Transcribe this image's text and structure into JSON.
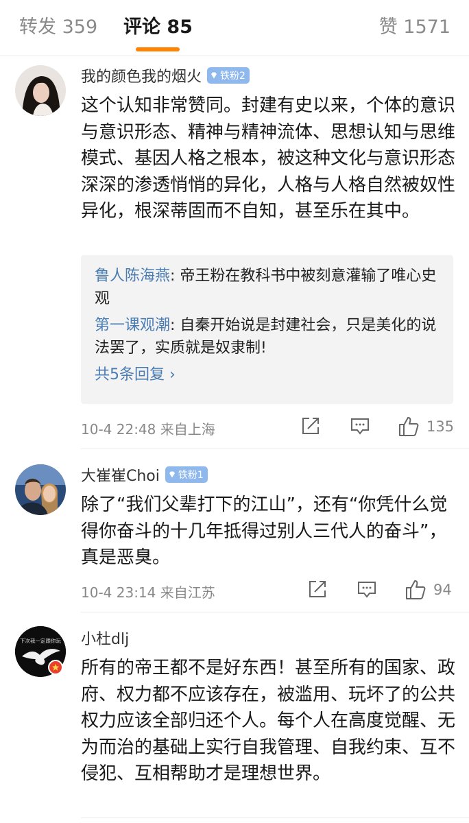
{
  "tabs": {
    "repost_label": "转发 359",
    "comments_label": "评论 85",
    "likes_label": "赞 1571",
    "active_color": "#ff8200"
  },
  "comments": [
    {
      "username": "我的颜色我的烟火",
      "badge": "铁粉2",
      "text": "这个认知非常赞同。封建有史以来，个体的意识与意识形态、精神与精神流体、思想认知与思维模式、基因人格之根本，被这种文化与意识形态深深的渗透悄悄的异化，人格与人格自然被奴性异化，根深蒂固而不自知，甚至乐在其中。",
      "replies": [
        {
          "name": "鲁人陈海燕",
          "text": ": 帝王粉在教科书中被刻意灌输了唯心史观"
        },
        {
          "name": "第一课观潮",
          "text": ": 自秦开始说是封建社会，只是美化的说法罢了，实质就是奴隶制!"
        }
      ],
      "more_replies": "共5条回复 ›",
      "meta": "10-4 22:48  来自上海",
      "like_count": "135"
    },
    {
      "username": "大崔崔Choi",
      "badge": "铁粉1",
      "text": "除了“我们父辈打下的江山”，还有“你凭什么觉得你奋斗的十几年抵得过别人三代人的奋斗”，真是恶臭。",
      "meta": "10-4 23:14  来自江苏",
      "like_count": "94"
    },
    {
      "username": "小杜dlj",
      "avatar_text": "下次我一定跟你玩",
      "text": "所有的帝王都不是好东西！甚至所有的国家、政府、权力都不应该存在，被滥用、玩坏了的公共权力应该全部归还个人。每个人在高度觉醒、无为而治的基础上实行自我管理、自我约束、互不侵犯、互相帮助才是理想世界。"
    }
  ],
  "icons": [
    "repost-icon",
    "comment-icon",
    "like-icon",
    "diamond-icon"
  ],
  "colors": {
    "link": "#4b7cb2",
    "badge": "#8fb8ec",
    "muted": "#888888"
  }
}
